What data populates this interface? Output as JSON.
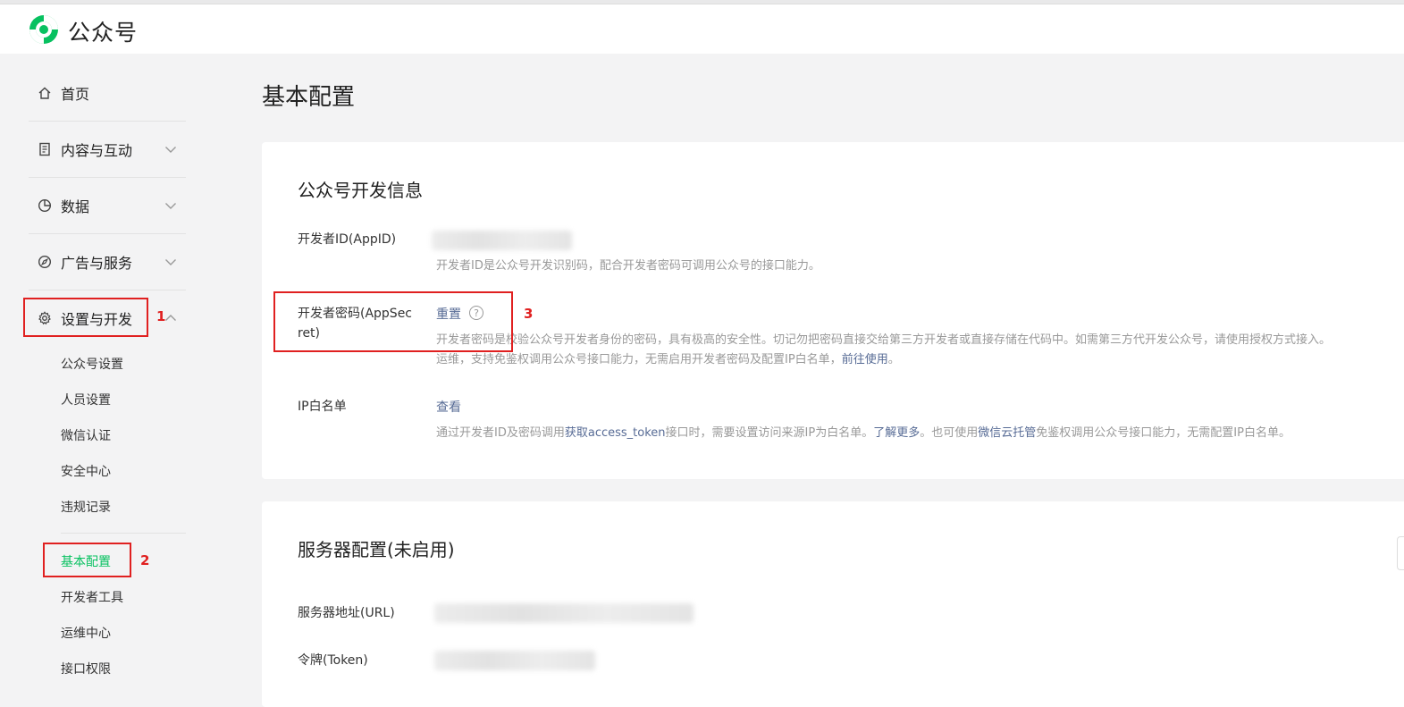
{
  "brand": {
    "name": "公众号",
    "logo_icon": "wechat-official-account-logo",
    "accent": "#07c160"
  },
  "sidebar": {
    "home": {
      "label": "首页",
      "icon": "home-icon"
    },
    "content": {
      "label": "内容与互动",
      "icon": "document-icon"
    },
    "data": {
      "label": "数据",
      "icon": "pie-chart-icon"
    },
    "ads": {
      "label": "广告与服务",
      "icon": "compass-icon"
    },
    "settings": {
      "label": "设置与开发",
      "icon": "gear-icon",
      "items": [
        "公众号设置",
        "人员设置",
        "微信认证",
        "安全中心",
        "违规记录",
        "基本配置",
        "开发者工具",
        "运维中心",
        "接口权限"
      ],
      "active": "基本配置"
    }
  },
  "annotations": {
    "n1": "1",
    "n2": "2",
    "n3": "3",
    "color": "#e02020"
  },
  "page": {
    "title": "基本配置"
  },
  "dev_info": {
    "title": "公众号开发信息",
    "appid": {
      "label": "开发者ID(AppID)",
      "desc": "开发者ID是公众号开发识别码，配合开发者密码可调用公众号的接口能力。"
    },
    "secret": {
      "label_line1": "开发者密码(AppSec",
      "label_line2": "ret)",
      "action": "重置",
      "desc_line1": "开发者密码是校验公众号开发者身份的密码，具有极高的安全性。切记勿把密码直接交给第三方开发者或直接存储在代码中。如需第三方代开发公众号，请使用授权方式接入。",
      "desc_line2_a": "运维，支持免鉴权调用公众号接口能力，无需启用开发者密码及配置IP白名单，",
      "desc_line2_link": "前往使用",
      "desc_line2_b": "。"
    },
    "ip": {
      "label": "IP白名单",
      "action": "查看",
      "desc_a": "通过开发者ID及密码调用",
      "desc_link1": "获取access_token",
      "desc_b": "接口时，需要设置访问来源IP为白名单。",
      "desc_link2": "了解更多",
      "desc_c": "。也可使用",
      "desc_link3": "微信云托管",
      "desc_d": "免鉴权调用公众号接口能力，无需配置IP白名单。"
    }
  },
  "server": {
    "title": "服务器配置(未启用)",
    "url_label": "服务器地址(URL)",
    "token_label": "令牌(Token)"
  }
}
